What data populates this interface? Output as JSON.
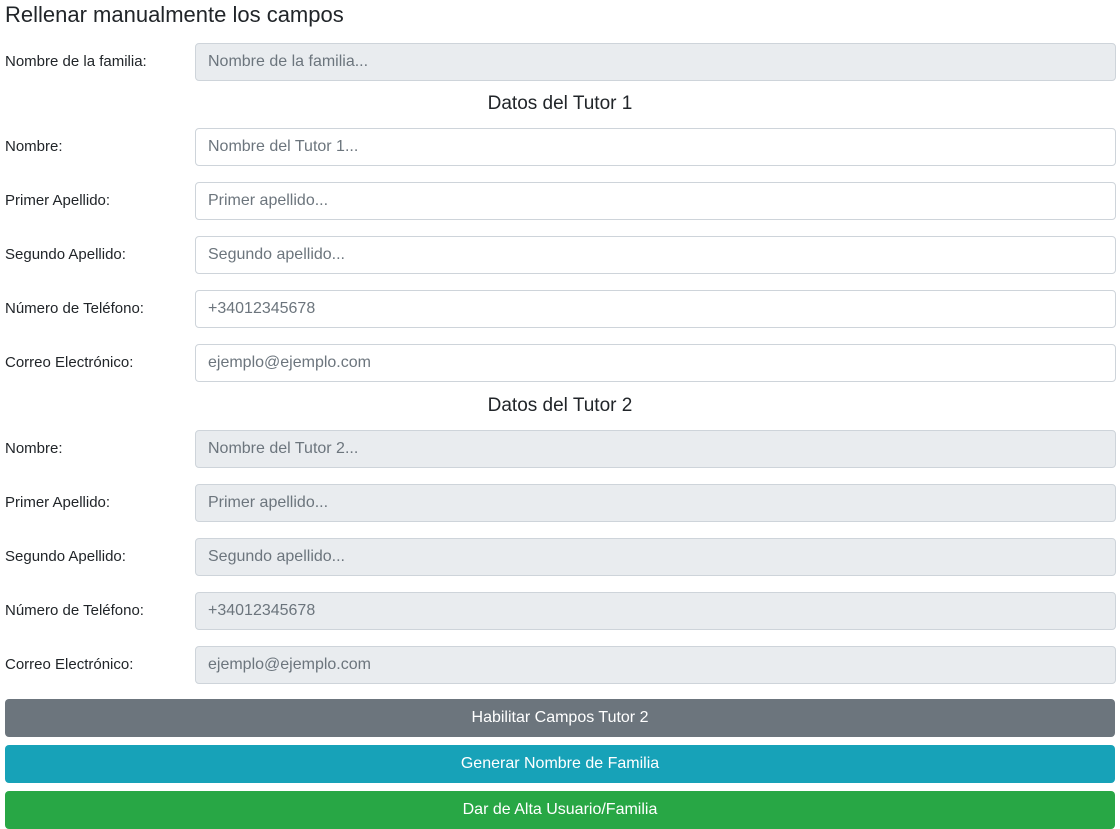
{
  "page": {
    "title": "Rellenar manualmente los campos"
  },
  "family": {
    "label": "Nombre de la familia:",
    "placeholder": "Nombre de la familia...",
    "disabled": true
  },
  "tutor1": {
    "title": "Datos del Tutor 1",
    "fields": [
      {
        "label": "Nombre:",
        "placeholder": "Nombre del Tutor 1...",
        "value": ""
      },
      {
        "label": "Primer Apellido:",
        "placeholder": "Primer apellido...",
        "value": ""
      },
      {
        "label": "Segundo Apellido:",
        "placeholder": "Segundo apellido...",
        "value": ""
      },
      {
        "label": "Número de Teléfono:",
        "placeholder": "+34012345678",
        "value": ""
      },
      {
        "label": "Correo Electrónico:",
        "placeholder": "ejemplo@ejemplo.com",
        "value": ""
      }
    ]
  },
  "tutor2": {
    "title": "Datos del Tutor 2",
    "disabled": true,
    "fields": [
      {
        "label": "Nombre:",
        "placeholder": "Nombre del Tutor 2...",
        "value": ""
      },
      {
        "label": "Primer Apellido:",
        "placeholder": "Primer apellido...",
        "value": ""
      },
      {
        "label": "Segundo Apellido:",
        "placeholder": "Segundo apellido...",
        "value": ""
      },
      {
        "label": "Número de Teléfono:",
        "placeholder": "+34012345678",
        "value": ""
      },
      {
        "label": "Correo Electrónico:",
        "placeholder": "ejemplo@ejemplo.com",
        "value": ""
      }
    ]
  },
  "buttons": {
    "enable_tutor2": "Habilitar Campos Tutor 2",
    "generate_family_name": "Generar Nombre de Familia",
    "register": "Dar de Alta Usuario/Familia"
  },
  "colors": {
    "secondary": "#6c757d",
    "info": "#17a2b8",
    "success": "#28a745",
    "disabled_field_bg": "#e9ecef"
  }
}
